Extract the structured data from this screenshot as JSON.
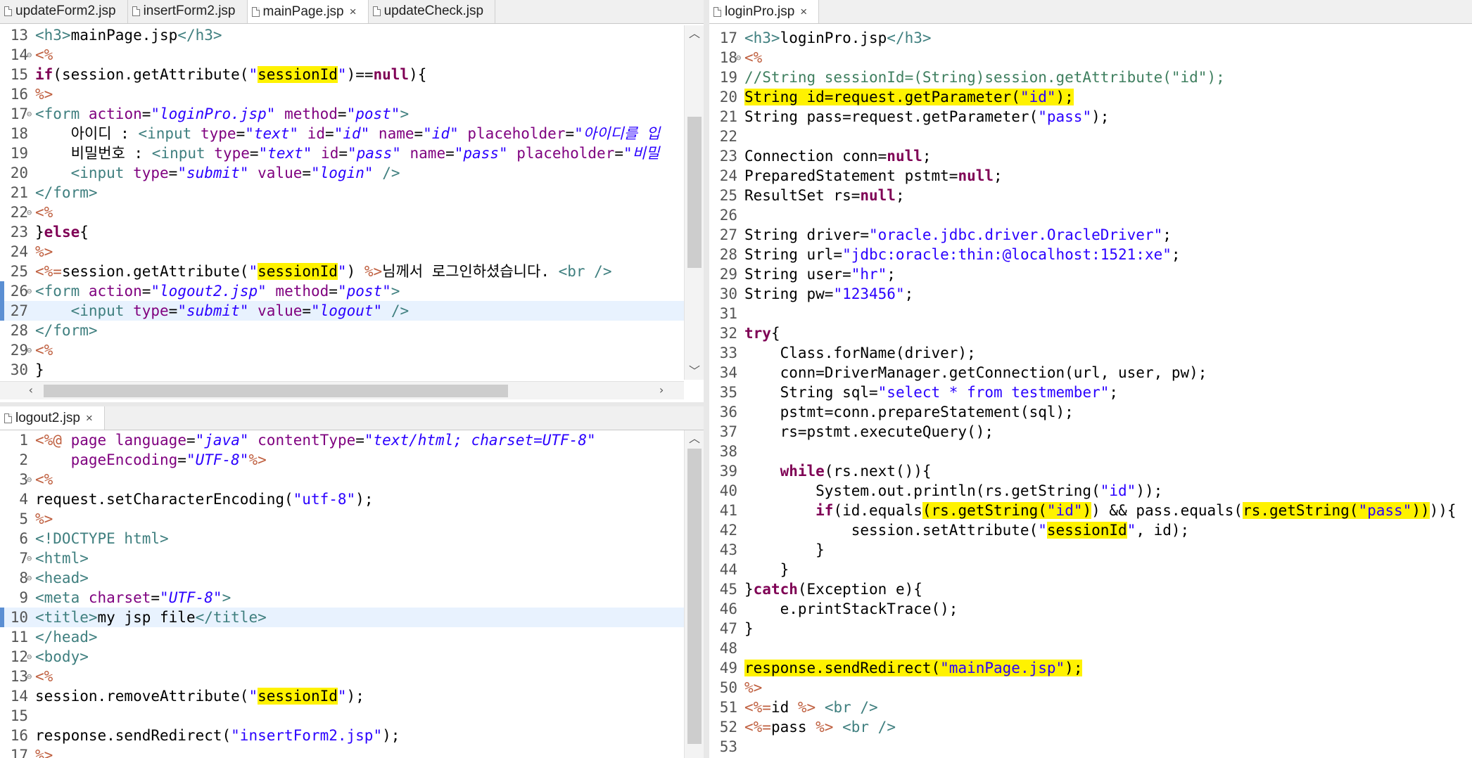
{
  "left_top": {
    "tabs": [
      {
        "label": "updateForm2.jsp"
      },
      {
        "label": "insertForm2.jsp"
      },
      {
        "label": "mainPage.jsp",
        "close": "×"
      },
      {
        "label": "updateCheck.jsp"
      }
    ],
    "lines": [
      {
        "n": "13",
        "fold": "",
        "html": "<span class='tag'>&lt;h3&gt;</span>mainPage.jsp<span class='tag'>&lt;/h3&gt;</span>"
      },
      {
        "n": "14",
        "fold": "⊖",
        "html": "<span class='dir'>&lt;%</span>"
      },
      {
        "n": "15",
        "fold": "",
        "html": "<span class='kw'>if</span>(session.getAttribute(<span class='str'>\"</span><span class='hl'>sessionId</span><span class='str'>\"</span>)==<span class='kw'>null</span>){"
      },
      {
        "n": "16",
        "fold": "",
        "html": "<span class='dir'>%&gt;</span>"
      },
      {
        "n": "17",
        "fold": "⊖",
        "html": "<span class='tag'>&lt;form</span> <span class='attr'>action</span>=<span class='istr'>\"loginPro.jsp\"</span> <span class='attr'>method</span>=<span class='istr'>\"post\"</span><span class='tag'>&gt;</span>"
      },
      {
        "n": "18",
        "fold": "",
        "html": "    아이디 : <span class='tag'>&lt;input</span> <span class='attr'>type</span>=<span class='istr'>\"text\"</span> <span class='attr'>id</span>=<span class='istr'>\"id\"</span> <span class='attr'>name</span>=<span class='istr'>\"id\"</span> <span class='attr'>placeholder</span>=<span class='istr'>\"아이디를 입</span>"
      },
      {
        "n": "19",
        "fold": "",
        "html": "    비밀번호 : <span class='tag'>&lt;input</span> <span class='attr'>type</span>=<span class='istr'>\"text\"</span> <span class='attr'>id</span>=<span class='istr'>\"pass\"</span> <span class='attr'>name</span>=<span class='istr'>\"pass\"</span> <span class='attr'>placeholder</span>=<span class='istr'>\"비밀</span>"
      },
      {
        "n": "20",
        "fold": "",
        "html": "    <span class='tag'>&lt;input</span> <span class='attr'>type</span>=<span class='istr'>\"submit\"</span> <span class='attr'>value</span>=<span class='istr'>\"login\"</span> <span class='tag'>/&gt;</span>"
      },
      {
        "n": "21",
        "fold": "",
        "html": "<span class='tag'>&lt;/form&gt;</span>"
      },
      {
        "n": "22",
        "fold": "⊖",
        "html": "<span class='dir'>&lt;%</span>"
      },
      {
        "n": "23",
        "fold": "",
        "html": "}<span class='kw'>else</span>{"
      },
      {
        "n": "24",
        "fold": "",
        "html": "<span class='dir'>%&gt;</span>"
      },
      {
        "n": "25",
        "fold": "",
        "html": "<span class='dir'>&lt;%=</span>session.getAttribute(<span class='str'>\"</span><span class='hl'>sessionId</span><span class='str'>\"</span>) <span class='dir'>%&gt;</span>님께서 로그인하셨습니다. <span class='tag'>&lt;br /&gt;</span>"
      },
      {
        "n": "26",
        "fold": "⊖",
        "html": "<span class='tag'>&lt;form</span> <span class='attr'>action</span>=<span class='istr'>\"logout2.jsp\"</span> <span class='attr'>method</span>=<span class='istr'>\"post\"</span><span class='tag'>&gt;</span>",
        "mark": true
      },
      {
        "n": "27",
        "fold": "",
        "html": "    <span class='tag'>&lt;input</span> <span class='attr'>type</span>=<span class='istr'>\"submit\"</span> <span class='attr'>value</span>=<span class='istr'>\"logout\"</span> <span class='tag'>/&gt;</span>",
        "current": true,
        "mark": true
      },
      {
        "n": "28",
        "fold": "",
        "html": "<span class='tag'>&lt;/form&gt;</span>"
      },
      {
        "n": "29",
        "fold": "⊖",
        "html": "<span class='dir'>&lt;%</span>"
      },
      {
        "n": "30",
        "fold": "",
        "html": "}"
      }
    ]
  },
  "left_bottom": {
    "tabs": [
      {
        "label": "logout2.jsp",
        "close": "×"
      }
    ],
    "lines": [
      {
        "n": "1",
        "fold": "",
        "html": "<span class='dir'>&lt;%@</span> <span class='attr'>page</span> <span class='attr'>language</span>=<span class='istr'>\"java\"</span> <span class='attr'>contentType</span>=<span class='istr'>\"text/html; charset=UTF-8\"</span>"
      },
      {
        "n": "2",
        "fold": "",
        "html": "    <span class='attr'>pageEncoding</span>=<span class='istr'>\"UTF-8\"</span><span class='dir'>%&gt;</span>"
      },
      {
        "n": "3",
        "fold": "⊖",
        "html": "<span class='dir'>&lt;%</span>"
      },
      {
        "n": "4",
        "fold": "",
        "html": "request.setCharacterEncoding(<span class='str'>\"utf-8\"</span>);"
      },
      {
        "n": "5",
        "fold": "",
        "html": "<span class='dir'>%&gt;</span>"
      },
      {
        "n": "6",
        "fold": "",
        "html": "<span class='tag'>&lt;!DOCTYPE html&gt;</span>"
      },
      {
        "n": "7",
        "fold": "⊖",
        "html": "<span class='tag'>&lt;html&gt;</span>"
      },
      {
        "n": "8",
        "fold": "⊖",
        "html": "<span class='tag'>&lt;head&gt;</span>"
      },
      {
        "n": "9",
        "fold": "",
        "html": "<span class='tag'>&lt;meta</span> <span class='attr'>charset</span>=<span class='istr'>\"UTF-8\"</span><span class='tag'>&gt;</span>"
      },
      {
        "n": "10",
        "fold": "",
        "html": "<span class='tag'>&lt;title&gt;</span>my jsp file<span class='tag'>&lt;/title&gt;</span>",
        "current": true,
        "mark": true
      },
      {
        "n": "11",
        "fold": "",
        "html": "<span class='tag'>&lt;/head&gt;</span>"
      },
      {
        "n": "12",
        "fold": "⊖",
        "html": "<span class='tag'>&lt;body&gt;</span>"
      },
      {
        "n": "13",
        "fold": "⊖",
        "html": "<span class='dir'>&lt;%</span>"
      },
      {
        "n": "14",
        "fold": "",
        "html": "session.removeAttribute(<span class='str'>\"</span><span class='hl'>sessionId</span><span class='str'>\"</span>);"
      },
      {
        "n": "15",
        "fold": "",
        "html": ""
      },
      {
        "n": "16",
        "fold": "",
        "html": "response.sendRedirect(<span class='str'>\"insertForm2.jsp\"</span>);"
      },
      {
        "n": "17",
        "fold": "",
        "html": "<span class='dir'>%&gt;</span>"
      }
    ]
  },
  "right": {
    "tabs": [
      {
        "label": "loginPro.jsp",
        "close": "×"
      }
    ],
    "lines": [
      {
        "n": "17",
        "fold": "",
        "html": "<span class='tag'>&lt;h3&gt;</span>loginPro.jsp<span class='tag'>&lt;/h3&gt;</span>"
      },
      {
        "n": "18",
        "fold": "⊖",
        "html": "<span class='dir'>&lt;%</span>"
      },
      {
        "n": "19",
        "fold": "",
        "html": "<span class='cmt'>//String sessionId=(String)session.getAttribute(\"id\");</span>"
      },
      {
        "n": "20",
        "fold": "",
        "html": "<span class='hl'>String id=request.getParameter(<span class='str'>\"id\"</span>);</span>"
      },
      {
        "n": "21",
        "fold": "",
        "html": "String pass=request.getParameter(<span class='str'>\"pass\"</span>);"
      },
      {
        "n": "22",
        "fold": "",
        "html": ""
      },
      {
        "n": "23",
        "fold": "",
        "html": "Connection conn=<span class='kw'>null</span>;"
      },
      {
        "n": "24",
        "fold": "",
        "html": "PreparedStatement pstmt=<span class='kw'>null</span>;"
      },
      {
        "n": "25",
        "fold": "",
        "html": "ResultSet rs=<span class='kw'>null</span>;"
      },
      {
        "n": "26",
        "fold": "",
        "html": ""
      },
      {
        "n": "27",
        "fold": "",
        "html": "String driver=<span class='str'>\"oracle.jdbc.driver.OracleDriver\"</span>;"
      },
      {
        "n": "28",
        "fold": "",
        "html": "String url=<span class='str'>\"jdbc:oracle:thin:@localhost:1521:xe\"</span>;"
      },
      {
        "n": "29",
        "fold": "",
        "html": "String user=<span class='str'>\"hr\"</span>;"
      },
      {
        "n": "30",
        "fold": "",
        "html": "String pw=<span class='str'>\"123456\"</span>;"
      },
      {
        "n": "31",
        "fold": "",
        "html": ""
      },
      {
        "n": "32",
        "fold": "",
        "html": "<span class='kw'>try</span>{"
      },
      {
        "n": "33",
        "fold": "",
        "html": "    Class.forName(driver);"
      },
      {
        "n": "34",
        "fold": "",
        "html": "    conn=DriverManager.getConnection(url, user, pw);"
      },
      {
        "n": "35",
        "fold": "",
        "html": "    String sql=<span class='str'>\"select * from testmember\"</span>;"
      },
      {
        "n": "36",
        "fold": "",
        "html": "    pstmt=conn.prepareStatement(sql);"
      },
      {
        "n": "37",
        "fold": "",
        "html": "    rs=pstmt.executeQuery();"
      },
      {
        "n": "38",
        "fold": "",
        "html": ""
      },
      {
        "n": "39",
        "fold": "",
        "html": "    <span class='kw'>while</span>(rs.next()){"
      },
      {
        "n": "40",
        "fold": "",
        "html": "        System.out.println(rs.getString(<span class='str'>\"id\"</span>));"
      },
      {
        "n": "41",
        "fold": "",
        "html": "        <span class='kw'>if</span>(id.equals<span class='hl'>(rs.getString(<span class='str'>\"id\"</span>)</span>) &amp;&amp; pass.equals(<span class='hl'>rs.getString(<span class='str'>\"pass\"</span>))</span>)){"
      },
      {
        "n": "42",
        "fold": "",
        "html": "            session.setAttribute(<span class='str'>\"</span><span class='hl'>sessionId</span><span class='str'>\"</span>, id);"
      },
      {
        "n": "43",
        "fold": "",
        "html": "        }"
      },
      {
        "n": "44",
        "fold": "",
        "html": "    }"
      },
      {
        "n": "45",
        "fold": "",
        "html": "}<span class='kw'>catch</span>(Exception e){"
      },
      {
        "n": "46",
        "fold": "",
        "html": "    e.printStackTrace();"
      },
      {
        "n": "47",
        "fold": "",
        "html": "}"
      },
      {
        "n": "48",
        "fold": "",
        "html": ""
      },
      {
        "n": "49",
        "fold": "",
        "html": "<span class='hl'>response.sendRedirect(<span class='str'>\"mainPage.jsp\"</span>);</span>"
      },
      {
        "n": "50",
        "fold": "",
        "html": "<span class='dir'>%&gt;</span>"
      },
      {
        "n": "51",
        "fold": "",
        "html": "<span class='dir'>&lt;%=</span>id <span class='dir'>%&gt;</span> <span class='tag'>&lt;br /&gt;</span>"
      },
      {
        "n": "52",
        "fold": "",
        "html": "<span class='dir'>&lt;%=</span>pass <span class='dir'>%&gt;</span> <span class='tag'>&lt;br /&gt;</span>"
      },
      {
        "n": "53",
        "fold": "",
        "html": ""
      }
    ]
  }
}
